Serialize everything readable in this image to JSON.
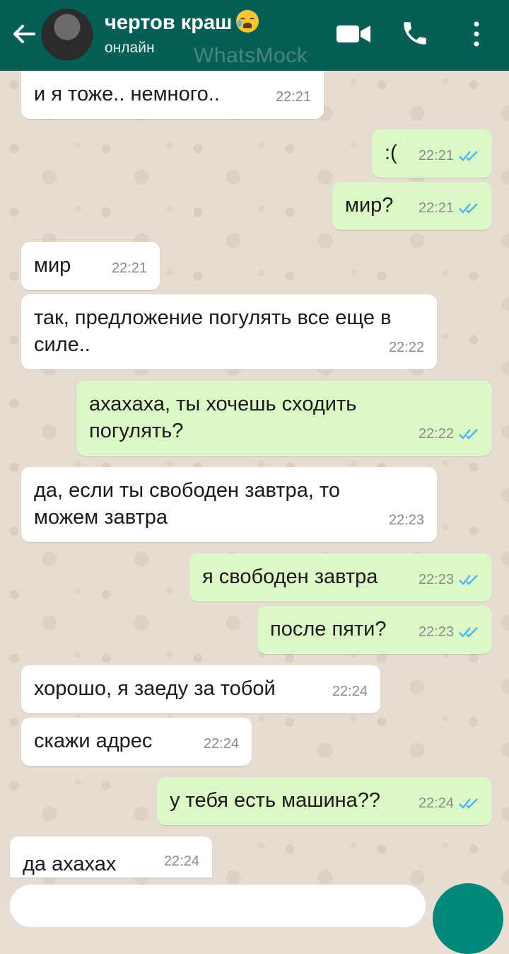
{
  "header": {
    "title": "чертов краш",
    "status": "онлайн",
    "watermark": "WhatsMock",
    "colors": {
      "bar": "#075e54",
      "outgoing": "#dcf8c6",
      "incoming": "#ffffff",
      "read_check": "#4fb6ec"
    }
  },
  "messages": [
    {
      "dir": "in",
      "text": "и я тоже.. немного..",
      "time": "22:21"
    },
    {
      "dir": "out",
      "text": ":(",
      "time": "22:21",
      "status": "read"
    },
    {
      "dir": "out",
      "text": "мир?",
      "time": "22:21",
      "status": "read"
    },
    {
      "dir": "in",
      "text": "мир",
      "time": "22:21"
    },
    {
      "dir": "in",
      "text": "так, предложение погулять все еще в силе..",
      "time": "22:22"
    },
    {
      "dir": "out",
      "text": "ахахаха, ты хочешь сходить погулять?",
      "time": "22:22",
      "status": "read"
    },
    {
      "dir": "in",
      "text": "да, если ты свободен завтра, то можем завтра",
      "time": "22:23"
    },
    {
      "dir": "out",
      "text": "я свободен завтра",
      "time": "22:23",
      "status": "read"
    },
    {
      "dir": "out",
      "text": "после пяти?",
      "time": "22:23",
      "status": "read"
    },
    {
      "dir": "in",
      "text": "хорошо, я заеду за тобой",
      "time": "22:24"
    },
    {
      "dir": "in",
      "text": "скажи адрес",
      "time": "22:24"
    },
    {
      "dir": "out",
      "text": "у тебя есть машина??",
      "time": "22:24",
      "status": "read"
    },
    {
      "dir": "in",
      "text": "да ахахах",
      "time": "22:24"
    }
  ]
}
